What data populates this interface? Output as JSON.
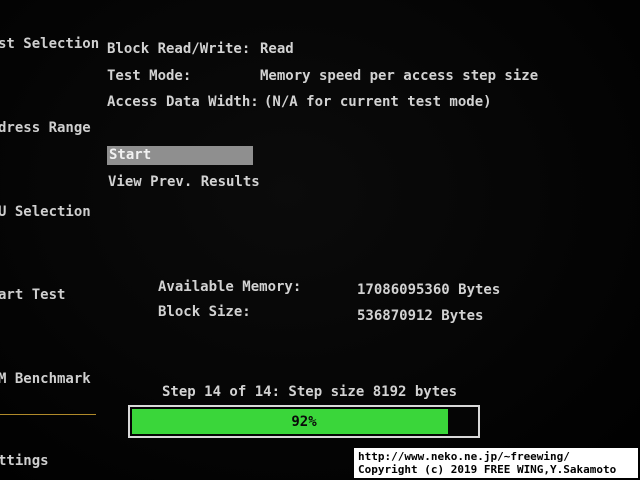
{
  "nav": {
    "items": [
      "st Selection",
      "dress Range",
      "U Selection",
      "art Test",
      "M Benchmark",
      "ttings"
    ]
  },
  "settings": {
    "block_rw_label": "Block Read/Write:",
    "block_rw_value": "Read",
    "test_mode_label": "Test Mode:",
    "test_mode_value": "Memory speed per access step size",
    "access_width_label": "Access Data Width:",
    "access_width_value": "(N/A for current test mode)"
  },
  "menu": {
    "start": "Start",
    "view_prev": "View Prev. Results"
  },
  "info": {
    "available_memory_label": "Available Memory:",
    "available_memory_value": "17086095360 Bytes",
    "block_size_label": "Block Size:",
    "block_size_value": "536870912 Bytes"
  },
  "progress": {
    "step_text": "Step 14 of 14: Step size 8192 bytes",
    "percent": 92,
    "percent_label": "92%",
    "fill_color": "#3ad63a"
  },
  "watermark": {
    "line1": "http://www.neko.ne.jp/~freewing/",
    "line2": "Copyright (c) 2019 FREE WING,Y.Sakamoto"
  }
}
